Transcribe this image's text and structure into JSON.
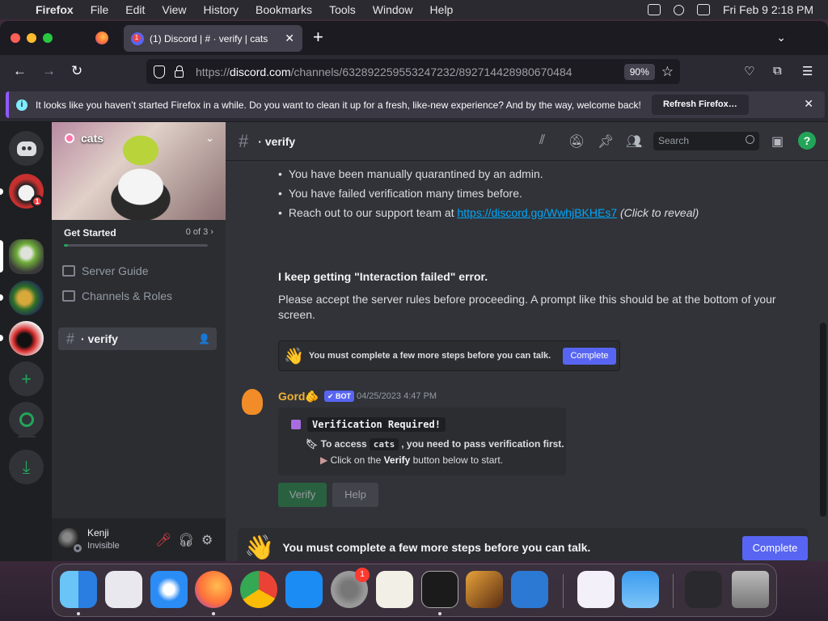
{
  "menubar": {
    "app": "Firefox",
    "items": [
      "File",
      "Edit",
      "View",
      "History",
      "Bookmarks",
      "Tools",
      "Window",
      "Help"
    ],
    "clock": "Fri Feb 9  2:18 PM"
  },
  "browser": {
    "tab_title": "(1) Discord | # · verify | cats",
    "url_domain": "discord.com",
    "url_prefix": "https://",
    "url_path": "/channels/632892259553247232/892714428980670484",
    "zoom": "90%",
    "notification": "It looks like you haven’t started Firefox in a while. Do you want to clean it up for a fresh, like-new experience? And by the way, welcome back!",
    "refresh_label": "Refresh Firefox…"
  },
  "servers": {
    "home_badge": "1"
  },
  "sidebar": {
    "server_name": "cats",
    "get_started": "Get Started",
    "progress_text": "0 of 3",
    "progress_fraction": 0.03,
    "items": [
      {
        "label": "Server Guide"
      },
      {
        "label": "Channels & Roles"
      }
    ],
    "active_channel": "verify"
  },
  "user": {
    "name": "Kenji",
    "status": "Invisible"
  },
  "header": {
    "channel": "verify",
    "search_placeholder": "Search"
  },
  "messages": {
    "bullets": [
      "You have been manually quarantined by an admin.",
      "You have failed verification many times before."
    ],
    "support_prefix": "Reach out to our support team at ",
    "support_link": "https://discord.gg/WwhjBKHEs7",
    "support_suffix": "(Click to reveal)",
    "heading": "I keep getting \"Interaction failed\" error.",
    "paragraph": "Please accept the server rules before proceeding. A prompt like this should be at the bottom of your screen.",
    "image_prompt_text": "You must complete a few more steps before you can talk.",
    "image_prompt_button": "Complete",
    "author": "Gord",
    "bot_tag": "✔ BOT",
    "timestamp": "04/25/2023 4:47 PM",
    "embed_title": "Verification Required!",
    "embed_line1_a": "To access",
    "embed_line1_code": "cats",
    "embed_line1_b": ", you need to pass verification first.",
    "embed_line2_a": "Click on the ",
    "embed_line2_b": "Verify",
    "embed_line2_c": " button below to start.",
    "verify_button": "Verify",
    "help_button": "Help"
  },
  "bottom_prompt": {
    "text": "You must complete a few more steps before you can talk.",
    "button": "Complete"
  },
  "dock": {
    "settings_badge": "1"
  },
  "colors": {
    "blurple": "#5865f2",
    "green": "#23a559",
    "link": "#00a8fc"
  }
}
